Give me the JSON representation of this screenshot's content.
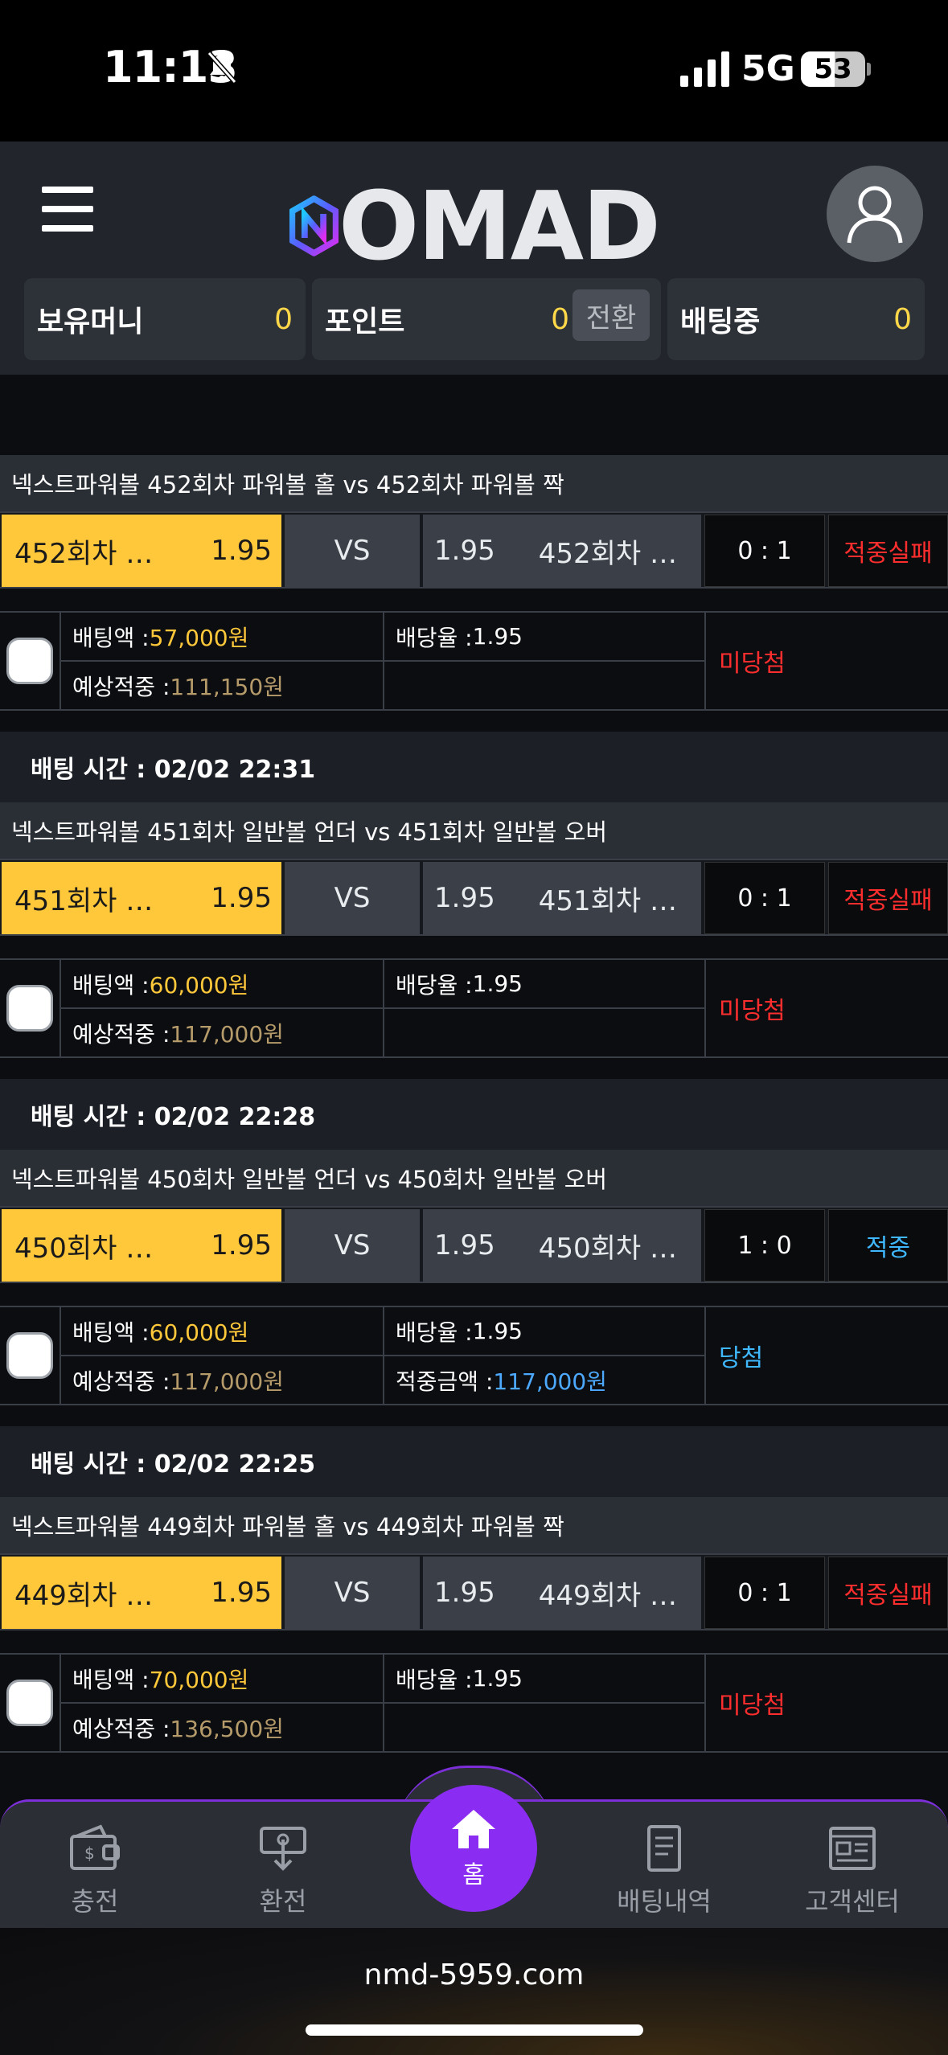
{
  "status_bar": {
    "time": "11:13",
    "network": "5G",
    "battery": "53",
    "battery_level": 0.53
  },
  "header": {
    "logo_text": "OMAD",
    "balances": [
      {
        "label": "보유머니",
        "value": "0"
      },
      {
        "label": "포인트",
        "value": "0",
        "action": "전환"
      },
      {
        "label": "배팅중",
        "value": "0"
      }
    ]
  },
  "bets": [
    {
      "title": "넥스트파워볼 452회차 파워볼 홀  vs  452회차 파워볼 짝",
      "home": "452회차 …",
      "home_odds": "1.95",
      "vs": "VS",
      "away_odds": "1.95",
      "away": "452회차 …",
      "score": "0 : 1",
      "result": "적중실패",
      "result_color": "#ff2e2e",
      "amount_label": "배팅액 :",
      "amount": "57,000원",
      "odds_label": "배당율 :",
      "odds": "1.95",
      "expected_label": "예상적중 :",
      "expected": "111,150원",
      "payout_label": "",
      "payout": "",
      "status": "미당첨",
      "status_color": "#ff2e2e"
    },
    {
      "time": "배팅 시간 : 02/02 22:31",
      "title": "넥스트파워볼 451회차 일반볼 언더  vs  451회차 일반볼 오버",
      "home": "451회차 …",
      "home_odds": "1.95",
      "vs": "VS",
      "away_odds": "1.95",
      "away": "451회차 …",
      "score": "0 : 1",
      "result": "적중실패",
      "result_color": "#ff2e2e",
      "amount_label": "배팅액 :",
      "amount": "60,000원",
      "odds_label": "배당율 :",
      "odds": "1.95",
      "expected_label": "예상적중 :",
      "expected": "117,000원",
      "payout_label": "",
      "payout": "",
      "status": "미당첨",
      "status_color": "#ff2e2e"
    },
    {
      "time": "배팅 시간 : 02/02 22:28",
      "title": "넥스트파워볼 450회차 일반볼 언더  vs  450회차 일반볼 오버",
      "home": "450회차 …",
      "home_odds": "1.95",
      "vs": "VS",
      "away_odds": "1.95",
      "away": "450회차 …",
      "score": "1 : 0",
      "result": "적중",
      "result_color": "#3fb8ff",
      "amount_label": "배팅액 :",
      "amount": "60,000원",
      "odds_label": "배당율 :",
      "odds": "1.95",
      "expected_label": "예상적중 :",
      "expected": "117,000원",
      "payout_label": "적중금액 :",
      "payout": "117,000원",
      "status": "당첨",
      "status_color": "#3fb8ff"
    },
    {
      "time": "배팅 시간 : 02/02 22:25",
      "title": "넥스트파워볼 449회차 파워볼 홀  vs  449회차 파워볼 짝",
      "home": "449회차 …",
      "home_odds": "1.95",
      "vs": "VS",
      "away_odds": "1.95",
      "away": "449회차 …",
      "score": "0 : 1",
      "result": "적중실패",
      "result_color": "#ff2e2e",
      "amount_label": "배팅액 :",
      "amount": "70,000원",
      "odds_label": "배당율 :",
      "odds": "1.95",
      "expected_label": "예상적중 :",
      "expected": "136,500원",
      "payout_label": "",
      "payout": "",
      "status": "미당첨",
      "status_color": "#ff2e2e"
    }
  ],
  "nav": {
    "deposit": "충전",
    "withdraw": "환전",
    "home": "홈",
    "history": "배팅내역",
    "support": "고객센터"
  },
  "url": "nmd-5959.com",
  "colors": {
    "accent": "#8a2cf2",
    "highlight": "#ffc83a",
    "fail": "#ff2e2e",
    "win": "#3fb8ff"
  }
}
